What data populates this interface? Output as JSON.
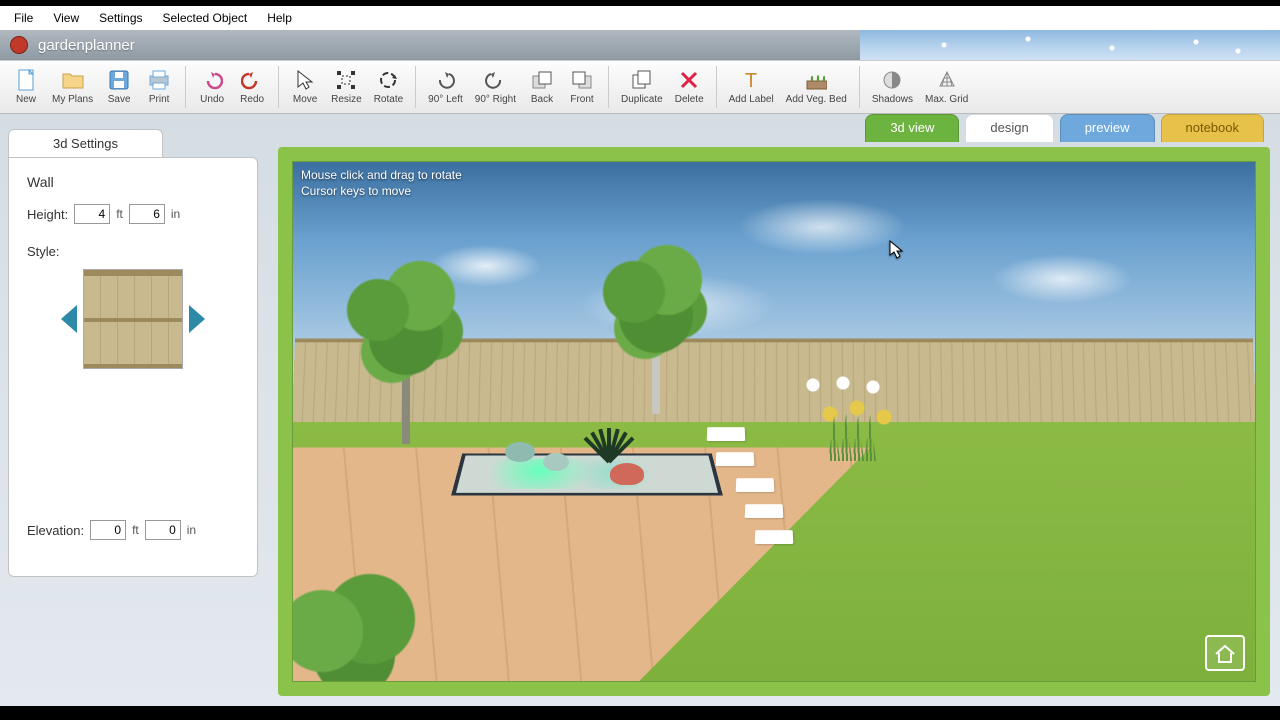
{
  "menubar": {
    "file": "File",
    "view": "View",
    "settings": "Settings",
    "selected": "Selected Object",
    "help": "Help"
  },
  "app": {
    "title": "gardenplanner"
  },
  "toolbar": {
    "new": "New",
    "myplans": "My Plans",
    "save": "Save",
    "print": "Print",
    "undo": "Undo",
    "redo": "Redo",
    "move": "Move",
    "resize": "Resize",
    "rotate": "Rotate",
    "left90": "90° Left",
    "right90": "90° Right",
    "back": "Back",
    "front": "Front",
    "duplicate": "Duplicate",
    "delete": "Delete",
    "addlabel": "Add Label",
    "addveg": "Add Veg. Bed",
    "shadows": "Shadows",
    "maxgrid": "Max. Grid"
  },
  "sidebar": {
    "tab": "3d Settings",
    "object": "Wall",
    "height_label": "Height:",
    "height_ft": "4",
    "height_in": "6",
    "style_label": "Style:",
    "elevation_label": "Elevation:",
    "elev_ft": "0",
    "elev_in": "0",
    "unit_ft": "ft",
    "unit_in": "in"
  },
  "viewtabs": {
    "v3d": "3d view",
    "design": "design",
    "preview": "preview",
    "notebook": "notebook"
  },
  "hint": {
    "l1": "Mouse click and drag to rotate",
    "l2": "Cursor keys to move"
  }
}
